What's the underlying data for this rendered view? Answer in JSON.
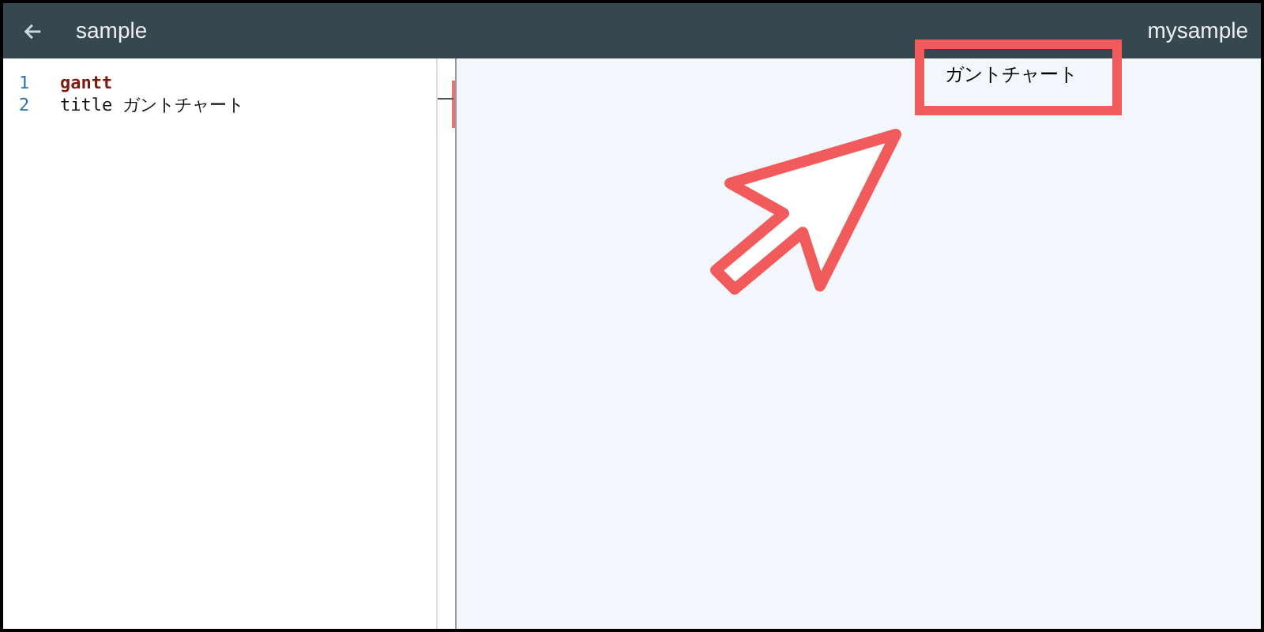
{
  "header": {
    "title": "sample",
    "project": "mysample"
  },
  "editor": {
    "lines": [
      {
        "number": "1",
        "tokens": [
          {
            "text": "gantt",
            "kind": "keyword"
          }
        ]
      },
      {
        "number": "2",
        "tokens": [
          {
            "text": "title ガントチャート",
            "kind": "plain"
          }
        ]
      }
    ]
  },
  "preview": {
    "chart_title": "ガントチャート"
  }
}
